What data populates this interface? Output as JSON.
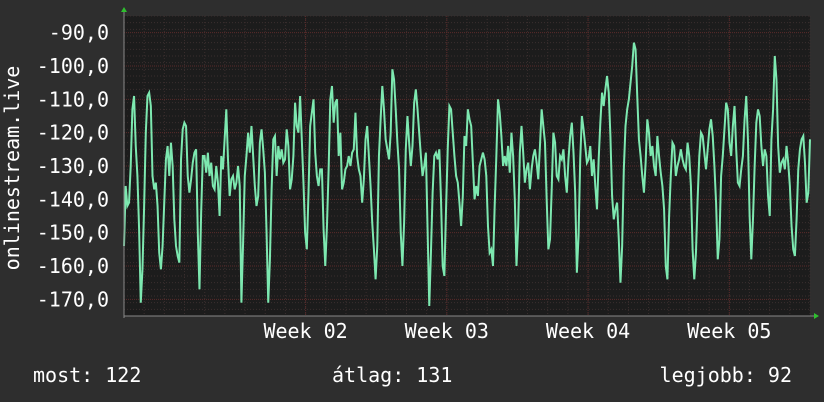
{
  "chart_data": {
    "type": "line",
    "ylabel": "onlinestream.live",
    "xlabel": "",
    "ylim": [
      -175,
      -85
    ],
    "y_ticks": [
      -90,
      -100,
      -110,
      -120,
      -130,
      -140,
      -150,
      -160,
      -170
    ],
    "y_tick_labels": [
      "-90,0",
      "-100,0",
      "-110,0",
      "-120,0",
      "-130,0",
      "-140,0",
      "-150,0",
      "-160,0",
      "-170,0"
    ],
    "x_range": [
      "2024-12-31",
      "2025-02-03"
    ],
    "x_ticks": [
      {
        "label": "Week 02",
        "date": "2025-01-09"
      },
      {
        "label": "Week 03",
        "date": "2025-01-16"
      },
      {
        "label": "Week 04",
        "date": "2025-01-23"
      },
      {
        "label": "Week 05",
        "date": "2025-01-30"
      }
    ],
    "grid": true,
    "colors": {
      "background": "#2e2e2e",
      "plot_background": "#1c1c1c",
      "line": "#7de8b0",
      "grid_minor": "#3a2e2e",
      "grid_major": "#5a2a2a",
      "axis_arrow": "#2fbf2f"
    },
    "series": [
      {
        "values": [
          -154,
          -136,
          -142,
          -141,
          -130,
          -113,
          -109,
          -124,
          -133,
          -149,
          -171,
          -161,
          -142,
          -120,
          -109,
          -108,
          -112,
          -133,
          -137,
          -135,
          -142,
          -156,
          -161,
          -154,
          -141,
          -128,
          -124,
          -133,
          -123,
          -130,
          -146,
          -154,
          -157,
          -159,
          -128,
          -119,
          -117,
          -118,
          -133,
          -138,
          -134,
          -129,
          -126,
          -125,
          -150,
          -167,
          -144,
          -127,
          -127,
          -132,
          -126,
          -133,
          -129,
          -136,
          -137,
          -130,
          -135,
          -145,
          -127,
          -131,
          -122,
          -113,
          -128,
          -139,
          -134,
          -133,
          -137,
          -135,
          -130,
          -136,
          -171,
          -153,
          -133,
          -127,
          -120,
          -126,
          -118,
          -127,
          -136,
          -142,
          -139,
          -123,
          -119,
          -125,
          -132,
          -150,
          -171,
          -158,
          -137,
          -122,
          -121,
          -133,
          -124,
          -128,
          -125,
          -129,
          -128,
          -119,
          -124,
          -137,
          -134,
          -127,
          -111,
          -118,
          -120,
          -109,
          -122,
          -135,
          -150,
          -155,
          -138,
          -118,
          -114,
          -110,
          -126,
          -133,
          -136,
          -131,
          -131,
          -149,
          -160,
          -148,
          -131,
          -110,
          -106,
          -117,
          -111,
          -110,
          -127,
          -120,
          -137,
          -135,
          -131,
          -130,
          -127,
          -130,
          -126,
          -125,
          -114,
          -127,
          -131,
          -133,
          -141,
          -134,
          -122,
          -118,
          -127,
          -136,
          -147,
          -155,
          -164,
          -154,
          -127,
          -116,
          -106,
          -113,
          -122,
          -125,
          -128,
          -120,
          -101,
          -104,
          -113,
          -123,
          -131,
          -150,
          -160,
          -147,
          -125,
          -115,
          -123,
          -130,
          -124,
          -111,
          -107,
          -113,
          -120,
          -127,
          -133,
          -130,
          -126,
          -149,
          -172,
          -156,
          -138,
          -127,
          -126,
          -128,
          -125,
          -140,
          -160,
          -163,
          -143,
          -125,
          -112,
          -113,
          -120,
          -127,
          -133,
          -135,
          -141,
          -148,
          -139,
          -121,
          -124,
          -113,
          -116,
          -118,
          -129,
          -140,
          -136,
          -139,
          -130,
          -128,
          -126,
          -128,
          -133,
          -148,
          -156,
          -155,
          -160,
          -142,
          -127,
          -110,
          -114,
          -121,
          -130,
          -127,
          -130,
          -124,
          -132,
          -120,
          -127,
          -140,
          -160,
          -148,
          -126,
          -118,
          -126,
          -135,
          -131,
          -129,
          -137,
          -131,
          -127,
          -125,
          -129,
          -134,
          -124,
          -113,
          -118,
          -123,
          -140,
          -155,
          -152,
          -137,
          -120,
          -123,
          -133,
          -134,
          -127,
          -128,
          -125,
          -133,
          -138,
          -128,
          -121,
          -117,
          -126,
          -138,
          -162,
          -151,
          -128,
          -115,
          -119,
          -124,
          -129,
          -128,
          -124,
          -133,
          -128,
          -136,
          -143,
          -128,
          -117,
          -108,
          -112,
          -107,
          -103,
          -108,
          -121,
          -139,
          -146,
          -143,
          -141,
          -152,
          -165,
          -154,
          -131,
          -118,
          -113,
          -110,
          -105,
          -100,
          -93,
          -95,
          -109,
          -122,
          -127,
          -133,
          -138,
          -129,
          -116,
          -120,
          -127,
          -124,
          -130,
          -133,
          -121,
          -127,
          -132,
          -136,
          -143,
          -160,
          -164,
          -145,
          -133,
          -123,
          -124,
          -133,
          -130,
          -128,
          -125,
          -128,
          -130,
          -131,
          -123,
          -127,
          -136,
          -155,
          -164,
          -156,
          -140,
          -127,
          -120,
          -121,
          -126,
          -131,
          -125,
          -119,
          -116,
          -121,
          -130,
          -141,
          -158,
          -152,
          -133,
          -127,
          -119,
          -111,
          -113,
          -123,
          -127,
          -118,
          -112,
          -125,
          -135,
          -136,
          -131,
          -127,
          -116,
          -109,
          -122,
          -145,
          -158,
          -146,
          -130,
          -117,
          -113,
          -115,
          -124,
          -130,
          -125,
          -127,
          -139,
          -145,
          -122,
          -113,
          -97,
          -104,
          -124,
          -132,
          -129,
          -128,
          -131,
          -124,
          -129,
          -136,
          -148,
          -155,
          -157,
          -146,
          -131,
          -125,
          -122,
          -121,
          -129,
          -141,
          -138,
          -122
        ]
      }
    ],
    "stats": [
      {
        "label": "most:",
        "value": "122"
      },
      {
        "label": "átlag:",
        "value": "131"
      },
      {
        "label": "legjobb:",
        "value": "92"
      }
    ]
  }
}
